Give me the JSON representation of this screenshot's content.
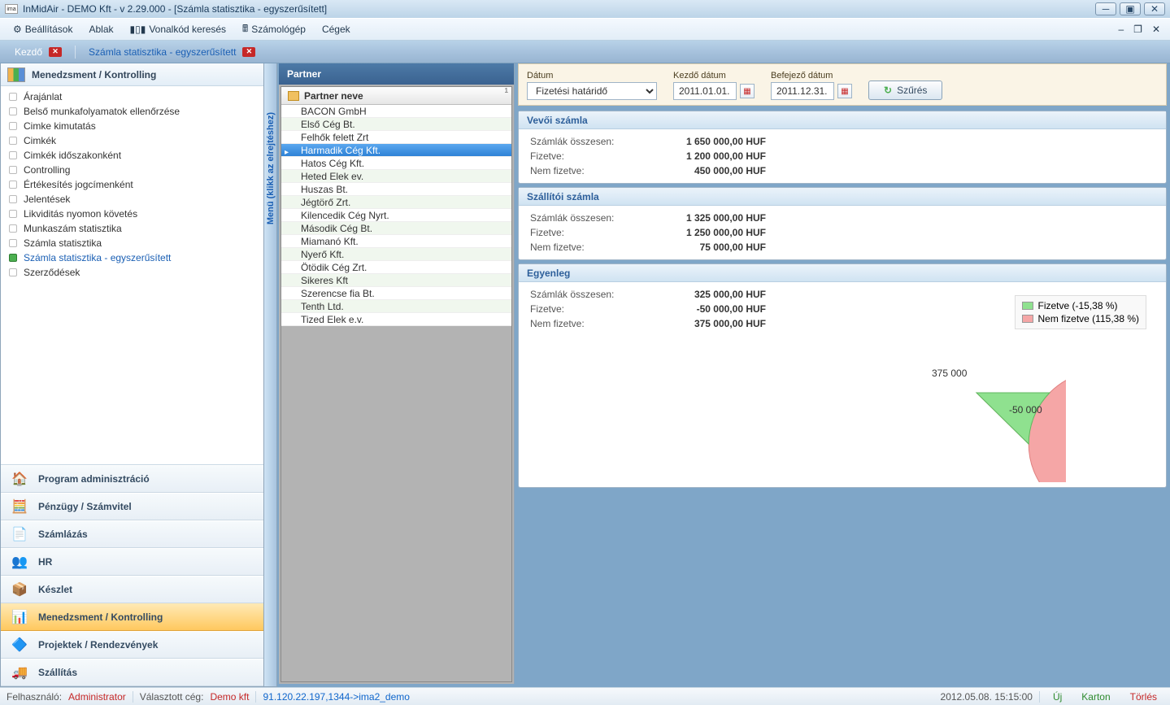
{
  "window": {
    "title": "InMidAir - DEMO Kft - v 2.29.000 - [Számla statisztika - egyszerűsített]",
    "app_icon_text": "ima"
  },
  "menubar": {
    "items": [
      {
        "label": "Beállítások",
        "icon": "gear"
      },
      {
        "label": "Ablak",
        "icon": ""
      },
      {
        "label": "Vonalkód keresés",
        "icon": "barcode"
      },
      {
        "label": "Számológép",
        "icon": "calc"
      },
      {
        "label": "Cégek",
        "icon": ""
      }
    ]
  },
  "tabs": [
    {
      "label": "Kezdő",
      "active": false,
      "closable": true
    },
    {
      "label": "Számla statisztika - egyszerűsített",
      "active": true,
      "closable": true
    }
  ],
  "sidebar": {
    "header": "Menedzsment / Kontrolling",
    "items": [
      "Árajánlat",
      "Belső munkafolyamatok ellenőrzése",
      "Cimke kimutatás",
      "Cimkék",
      "Cimkék időszakonként",
      "Controlling",
      "Értékesítés jogcímenként",
      "Jelentések",
      "Likviditás nyomon követés",
      "Munkaszám statisztika",
      "Számla statisztika",
      "Számla statisztika - egyszerűsített",
      "Szerződések"
    ],
    "selected_index": 11,
    "collapse_label": "Menü (klikk az elrejtéshez)",
    "modules": [
      {
        "label": "Program adminisztráció",
        "icon": "🏠",
        "icon_color": "#d84a2f"
      },
      {
        "label": "Pénzügy / Számvitel",
        "icon": "🧮",
        "icon_color": "#4a7fce"
      },
      {
        "label": "Számlázás",
        "icon": "📄",
        "icon_color": "#7b8a99"
      },
      {
        "label": "HR",
        "icon": "👥",
        "icon_color": "#c05a7a"
      },
      {
        "label": "Készlet",
        "icon": "📦",
        "icon_color": "#d89a3a"
      },
      {
        "label": "Menedzsment / Kontrolling",
        "icon": "📊",
        "icon_color": "#4caf50",
        "active": true
      },
      {
        "label": "Projektek / Rendezvények",
        "icon": "🔷",
        "icon_color": "#3a7fce"
      },
      {
        "label": "Szállítás",
        "icon": "🚚",
        "icon_color": "#6a8aa8"
      }
    ]
  },
  "partners": {
    "title": "Partner",
    "column": "Partner neve",
    "corner": "1",
    "rows": [
      "BACON GmbH",
      "Első Cég Bt.",
      "Felhők felett Zrt",
      "Harmadik Cég Kft.",
      "Hatos Cég Kft.",
      "Heted Elek ev.",
      "Huszas Bt.",
      "Jégtörő Zrt.",
      "Kilencedik Cég Nyrt.",
      "Második Cég Bt.",
      "Miamanó Kft.",
      "Nyerő Kft.",
      "Ötödik Cég Zrt.",
      "Sikeres Kft",
      "Szerencse fia Bt.",
      "Tenth Ltd.",
      "Tized Elek e.v."
    ],
    "selected_index": 3
  },
  "filters": {
    "date_label": "Dátum",
    "date_type_value": "Fizetési határidő",
    "start_label": "Kezdő dátum",
    "start_value": "2011.01.01.",
    "end_label": "Befejező dátum",
    "end_value": "2011.12.31.",
    "filter_button": "Szűrés"
  },
  "summary": {
    "customer": {
      "title": "Vevői számla",
      "total_label": "Számlák összesen:",
      "total_value": "1 650 000,00 HUF",
      "paid_label": "Fizetve:",
      "paid_value": "1 200 000,00 HUF",
      "unpaid_label": "Nem fizetve:",
      "unpaid_value": "450 000,00 HUF"
    },
    "supplier": {
      "title": "Szállítói számla",
      "total_label": "Számlák összesen:",
      "total_value": "1 325 000,00 HUF",
      "paid_label": "Fizetve:",
      "paid_value": "1 250 000,00 HUF",
      "unpaid_label": "Nem fizetve:",
      "unpaid_value": "75 000,00 HUF"
    },
    "balance": {
      "title": "Egyenleg",
      "total_label": "Számlák összesen:",
      "total_value": "325 000,00 HUF",
      "paid_label": "Fizetve:",
      "paid_value": "-50 000,00 HUF",
      "unpaid_label": "Nem fizetve:",
      "unpaid_value": "375 000,00 HUF"
    }
  },
  "chart_data": {
    "type": "pie",
    "series": [
      {
        "name": "Fizetve",
        "value": -50000,
        "label": "-50 000",
        "legend": "Fizetve (-15,38 %)",
        "color": "#8fe18f"
      },
      {
        "name": "Nem fizetve",
        "value": 375000,
        "label": "375 000",
        "legend": "Nem fizetve (115,38 %)",
        "color": "#f5a6a6"
      }
    ]
  },
  "status": {
    "user_label": "Felhasználó:",
    "user_value": "Administrator",
    "company_label": "Választott cég:",
    "company_value": "Demo kft",
    "connection": "91.120.22.197,1344->ima2_demo",
    "datetime": "2012.05.08. 15:15:00",
    "action_new": "Új",
    "action_card": "Karton",
    "action_delete": "Törlés"
  }
}
